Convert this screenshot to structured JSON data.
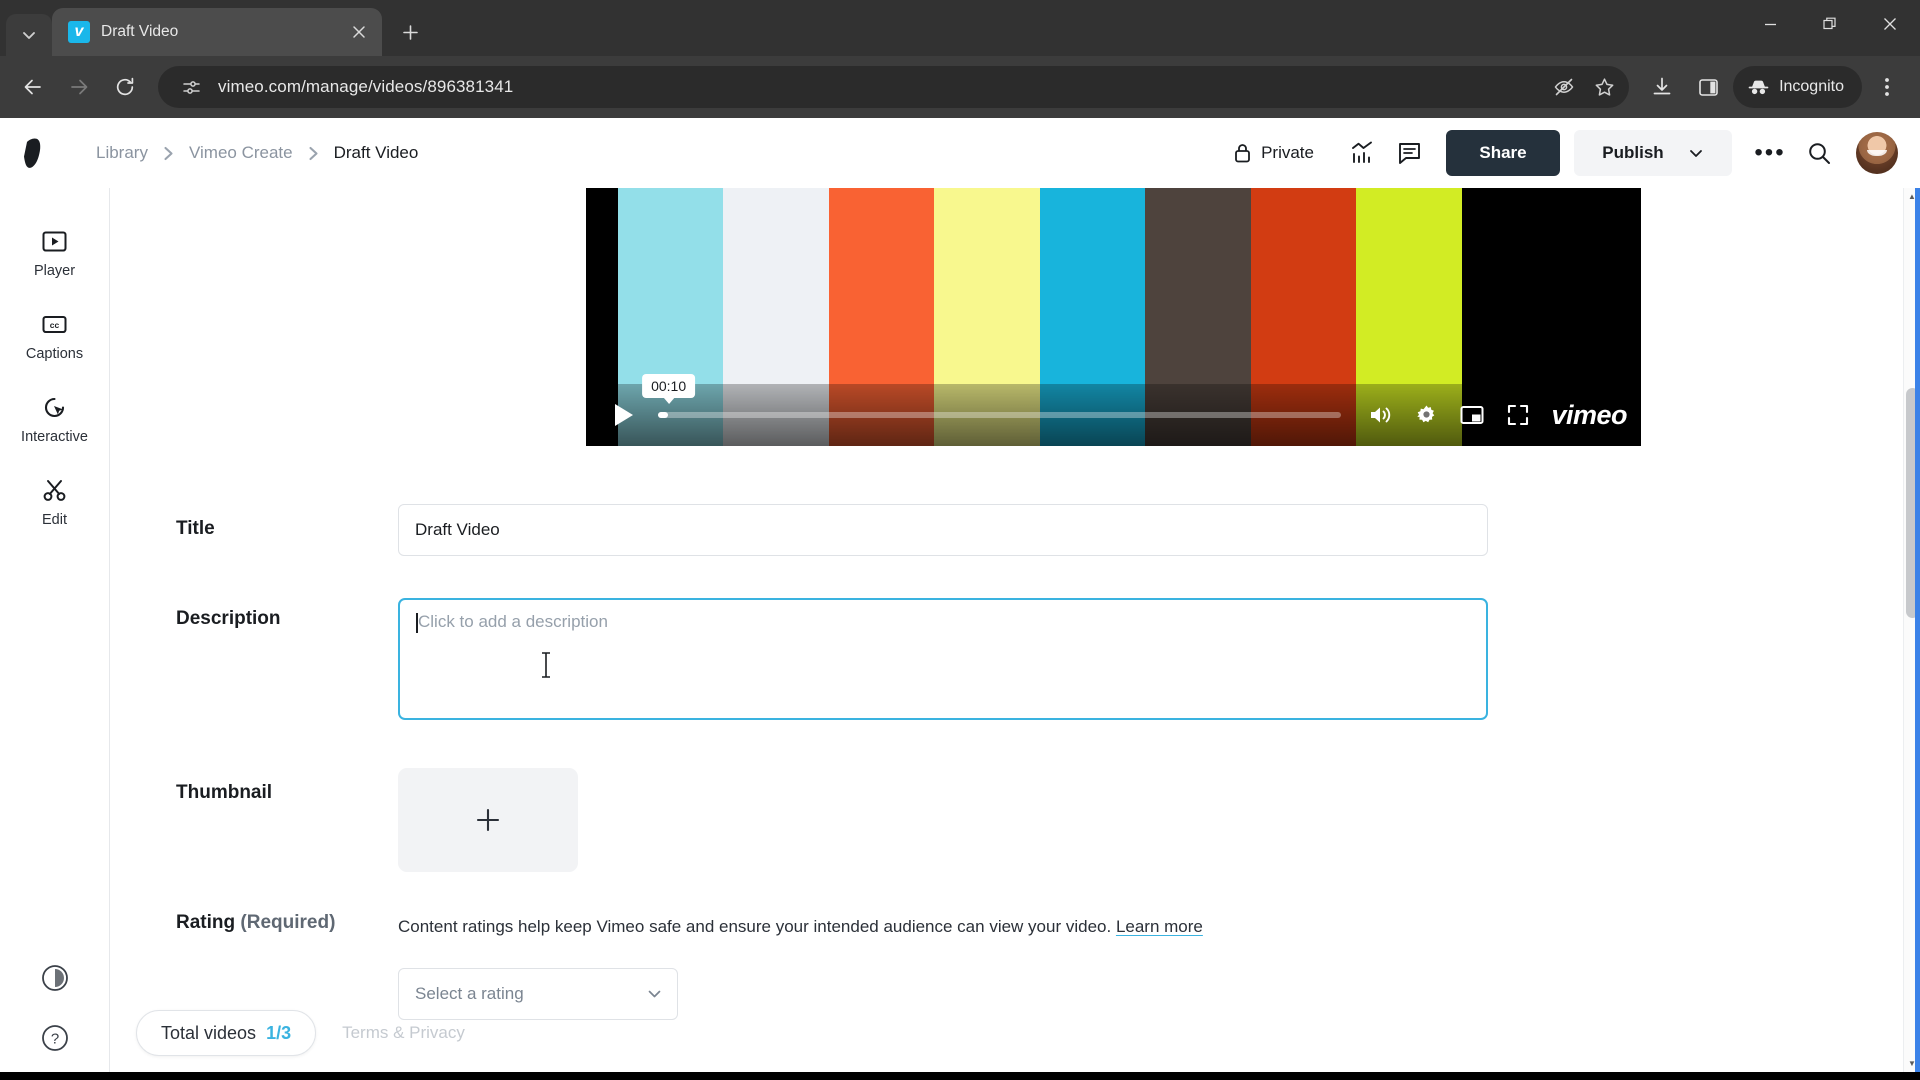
{
  "browser": {
    "tab": {
      "title": "Draft Video",
      "favicon": "vimeo-favicon",
      "close_label": "×"
    },
    "tab_search_icon": "chevron-down-icon",
    "new_tab_label": "+",
    "window": {
      "minimize": "−",
      "restore": "❐",
      "close": "✕"
    },
    "nav": {
      "back": "←",
      "forward": "→",
      "reload": "⟳"
    },
    "address": {
      "url": "vimeo.com/manage/videos/896381341",
      "site_info_icon": "site-settings-icon",
      "tracking_icon": "eye-off-icon",
      "bookmark_icon": "star-icon"
    },
    "toolbar": {
      "download_icon": "download-icon",
      "side_panel_icon": "side-panel-icon",
      "incognito_label": "Incognito",
      "incognito_icon": "incognito-hat-icon",
      "menu_icon": "three-dot-menu-icon"
    }
  },
  "header": {
    "logo": "vimeo-logo",
    "breadcrumbs": [
      {
        "label": "Library",
        "active": false
      },
      {
        "label": "Vimeo Create",
        "active": false
      },
      {
        "label": "Draft Video",
        "active": true
      }
    ],
    "separator": "›",
    "privacy": {
      "label": "Private",
      "icon": "lock-icon"
    },
    "stats_icon": "stats-chart-icon",
    "comments_icon": "comment-icon",
    "share_label": "Share",
    "publish_label": "Publish",
    "publish_caret": "chevron-down-icon",
    "more_label": "•••",
    "search_icon": "search-icon",
    "avatar": "user-avatar"
  },
  "sidebar": {
    "items": [
      {
        "label": "Player",
        "icon": "player-icon"
      },
      {
        "label": "Captions",
        "icon": "captions-cc-icon"
      },
      {
        "label": "Interactive",
        "icon": "interactive-cursor-icon"
      },
      {
        "label": "Edit",
        "icon": "scissors-edit-icon"
      }
    ],
    "bottom": [
      {
        "icon": "contrast-circle-icon"
      },
      {
        "icon": "help-question-icon"
      }
    ]
  },
  "player": {
    "play_icon": "play-icon",
    "time_tooltip": "00:10",
    "progress_percent": 1.5,
    "volume_icon": "volume-icon",
    "settings_icon": "gear-icon",
    "pip_icon": "picture-in-picture-icon",
    "fullscreen_icon": "fullscreen-icon",
    "watermark": "vimeo",
    "color_bars": [
      {
        "color": "#000000",
        "width": 3
      },
      {
        "color": "#93dfe9",
        "width": 10
      },
      {
        "color": "#eef1f5",
        "width": 10
      },
      {
        "color": "#f96233",
        "width": 10
      },
      {
        "color": "#f8f88e",
        "width": 10
      },
      {
        "color": "#18b4dc",
        "width": 10
      },
      {
        "color": "#4e433d",
        "width": 10
      },
      {
        "color": "#d23c12",
        "width": 10
      },
      {
        "color": "#d2ec24",
        "width": 10
      },
      {
        "color": "#000000",
        "width": 3
      }
    ]
  },
  "form": {
    "title": {
      "label": "Title",
      "value": "Draft Video"
    },
    "description": {
      "label": "Description",
      "value": "",
      "placeholder": "Click to add a description",
      "focused": true
    },
    "thumbnail": {
      "label": "Thumbnail",
      "add_icon": "plus-icon"
    },
    "rating": {
      "label": "Rating",
      "required_suffix": "(Required)",
      "help_text": "Content ratings help keep Vimeo safe and ensure your intended audience can view your video.",
      "learn_more": "Learn more",
      "select_value": "Select a rating",
      "select_caret": "chevron-down-icon"
    }
  },
  "footer": {
    "total_videos_label": "Total videos",
    "total_videos_count": "1/3",
    "terms": "Terms & Privacy"
  },
  "colors": {
    "accent": "#3ab3e0",
    "share_bg": "#25313c",
    "publish_bg": "#f3f4f6",
    "focus_ring": "#3b82e8"
  }
}
